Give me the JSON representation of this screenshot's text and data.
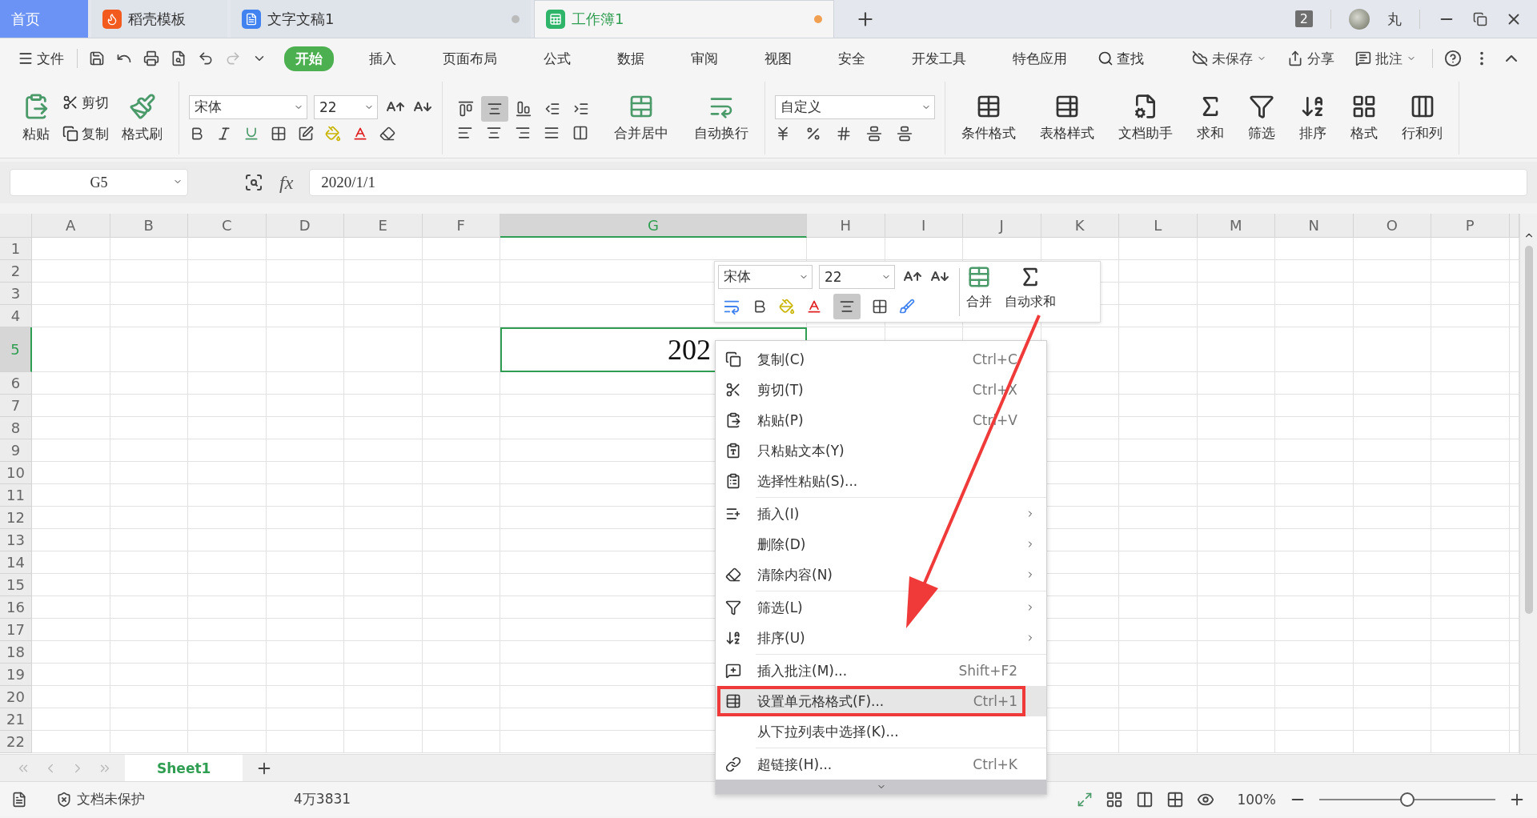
{
  "tabs": [
    {
      "label": "首页",
      "kind": "home",
      "selected": false
    },
    {
      "label": "稻壳模板",
      "kind": "docer",
      "selected": false
    },
    {
      "label": "文字文稿1",
      "kind": "writer",
      "selected": false
    },
    {
      "label": "工作簿1",
      "kind": "sheet",
      "selected": true
    }
  ],
  "window_count": "2",
  "user": "丸",
  "menu": {
    "file": "文件",
    "tabs": [
      {
        "label": "开始",
        "selected": true
      },
      {
        "label": "插入",
        "selected": false
      },
      {
        "label": "页面布局",
        "selected": false
      },
      {
        "label": "公式",
        "selected": false
      },
      {
        "label": "数据",
        "selected": false
      },
      {
        "label": "审阅",
        "selected": false
      },
      {
        "label": "视图",
        "selected": false
      },
      {
        "label": "安全",
        "selected": false
      },
      {
        "label": "开发工具",
        "selected": false
      },
      {
        "label": "特色应用",
        "selected": false
      }
    ],
    "search": "查找",
    "actions": [
      "未保存",
      "分享",
      "批注"
    ]
  },
  "ribbon": {
    "paste": "粘贴",
    "cut": "剪切",
    "copy": "复制",
    "format_painter": "格式刷",
    "font": "宋体",
    "size": "22",
    "alignment": [
      {
        "selected": false
      },
      {
        "selected": true
      },
      {
        "selected": false
      },
      {
        "selected": false
      },
      {
        "selected": false
      }
    ],
    "merge": "合并居中",
    "wrap": "自动换行",
    "number_format": "自定义",
    "big": [
      "条件格式",
      "表格样式",
      "文档助手",
      "求和",
      "筛选",
      "排序",
      "格式",
      "行和列"
    ]
  },
  "name_box": "G5",
  "fx_label": "fx",
  "formula": "2020/1/1",
  "columns": [
    {
      "label": "A",
      "selected": false
    },
    {
      "label": "B",
      "selected": false
    },
    {
      "label": "C",
      "selected": false
    },
    {
      "label": "D",
      "selected": false
    },
    {
      "label": "E",
      "selected": false
    },
    {
      "label": "F",
      "selected": false
    },
    {
      "label": "G",
      "selected": true
    },
    {
      "label": "H",
      "selected": false
    },
    {
      "label": "I",
      "selected": false
    },
    {
      "label": "J",
      "selected": false
    },
    {
      "label": "K",
      "selected": false
    },
    {
      "label": "L",
      "selected": false
    },
    {
      "label": "M",
      "selected": false
    },
    {
      "label": "N",
      "selected": false
    },
    {
      "label": "O",
      "selected": false
    },
    {
      "label": "P",
      "selected": false
    }
  ],
  "rows": [
    {
      "label": "1",
      "selected": false
    },
    {
      "label": "2",
      "selected": false
    },
    {
      "label": "3",
      "selected": false
    },
    {
      "label": "4",
      "selected": false
    },
    {
      "label": "5",
      "selected": true
    },
    {
      "label": "6",
      "selected": false
    },
    {
      "label": "7",
      "selected": false
    },
    {
      "label": "8",
      "selected": false
    },
    {
      "label": "9",
      "selected": false
    },
    {
      "label": "10",
      "selected": false
    },
    {
      "label": "11",
      "selected": false
    },
    {
      "label": "12",
      "selected": false
    },
    {
      "label": "13",
      "selected": false
    },
    {
      "label": "14",
      "selected": false
    },
    {
      "label": "15",
      "selected": false
    },
    {
      "label": "16",
      "selected": false
    },
    {
      "label": "17",
      "selected": false
    },
    {
      "label": "18",
      "selected": false
    },
    {
      "label": "19",
      "selected": false
    },
    {
      "label": "20",
      "selected": false
    },
    {
      "label": "21",
      "selected": false
    },
    {
      "label": "22",
      "selected": false
    }
  ],
  "active_cell": {
    "text": "202"
  },
  "mini_toolbar": {
    "font": "宋体",
    "size": "22",
    "merge": "合并",
    "autosum": "自动求和"
  },
  "context_menu": [
    [
      {
        "label": "复制(C)",
        "shortcut": "Ctrl+C",
        "submenu": false,
        "highlighted": false
      },
      {
        "label": "剪切(T)",
        "shortcut": "Ctrl+X",
        "submenu": false,
        "highlighted": false
      },
      {
        "label": "粘贴(P)",
        "shortcut": "Ctrl+V",
        "submenu": false,
        "highlighted": false
      },
      {
        "label": "只粘贴文本(Y)",
        "submenu": false,
        "highlighted": false
      },
      {
        "label": "选择性粘贴(S)...",
        "submenu": false,
        "highlighted": false
      }
    ],
    [
      {
        "label": "插入(I)",
        "submenu": true,
        "highlighted": false
      },
      {
        "label": "删除(D)",
        "submenu": true,
        "highlighted": false
      },
      {
        "label": "清除内容(N)",
        "submenu": true,
        "highlighted": false
      }
    ],
    [
      {
        "label": "筛选(L)",
        "submenu": true,
        "highlighted": false
      },
      {
        "label": "排序(U)",
        "submenu": true,
        "highlighted": false
      }
    ],
    [
      {
        "label": "插入批注(M)...",
        "shortcut": "Shift+F2",
        "submenu": false,
        "highlighted": false
      },
      {
        "label": "设置单元格格式(F)...",
        "shortcut": "Ctrl+1",
        "submenu": false,
        "highlighted": true
      },
      {
        "label": "从下拉列表中选择(K)...",
        "submenu": false,
        "highlighted": false
      }
    ],
    [
      {
        "label": "超链接(H)...",
        "shortcut": "Ctrl+K",
        "submenu": false,
        "highlighted": false
      }
    ]
  ],
  "sheet_tabs": [
    {
      "label": "Sheet1",
      "selected": true
    }
  ],
  "status": {
    "protection": "文档未保护",
    "count": "4万3831",
    "zoom": "100%",
    "level": 0.5
  }
}
